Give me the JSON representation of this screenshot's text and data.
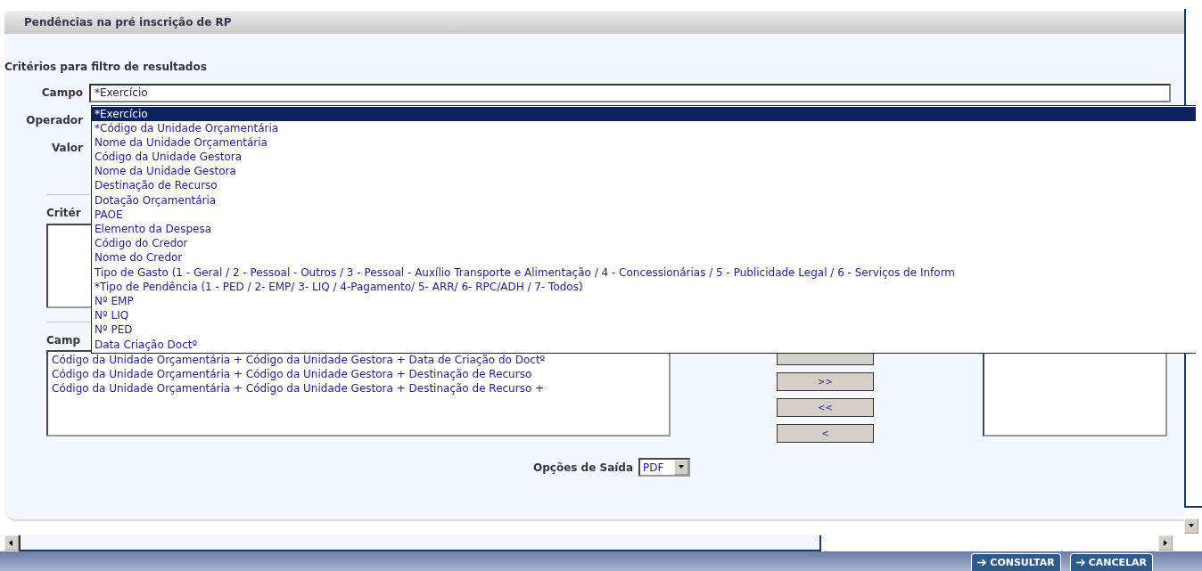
{
  "header": {
    "title": "Pendências na pré inscrição de RP"
  },
  "filter": {
    "title": "Critérios para filtro de resultados",
    "fields": [
      {
        "label": "Campo",
        "value": "*Exercício"
      },
      {
        "label": "Operador"
      },
      {
        "label": "Valor"
      }
    ]
  },
  "campo_options": [
    {
      "label": "*Exercício",
      "selected": true
    },
    {
      "label": "*Código da Unidade Orçamentária",
      "selected": false
    },
    {
      "label": "Nome da Unidade Orçamentária",
      "selected": false
    },
    {
      "label": "Código da Unidade Gestora",
      "selected": false
    },
    {
      "label": "Nome da Unidade Gestora",
      "selected": false
    },
    {
      "label": "Destinação de Recurso",
      "selected": false
    },
    {
      "label": "Dotação Orçamentária",
      "selected": false
    },
    {
      "label": "PAOE",
      "selected": false
    },
    {
      "label": "Elemento da Despesa",
      "selected": false
    },
    {
      "label": "Código do Credor",
      "selected": false
    },
    {
      "label": "Nome do Credor",
      "selected": false
    },
    {
      "label": "Tipo de Gasto (1 - Geral / 2 - Pessoal - Outros / 3 - Pessoal - Auxílio Transporte e Alimentação / 4 - Concessionárias / 5 - Publicidade Legal / 6 - Serviços de Inform",
      "selected": false
    },
    {
      "label": "*Tipo de Pendência (1 - PED / 2- EMP/ 3- LIQ / 4-Pagamento/ 5- ARR/ 6- RPC/ADH / 7- Todos)",
      "selected": false
    },
    {
      "label": "Nº EMP",
      "selected": false
    },
    {
      "label": "Nº LIQ",
      "selected": false
    },
    {
      "label": "Nº PED",
      "selected": false
    },
    {
      "label": "Data Criação Doctº",
      "selected": false
    }
  ],
  "criteria": {
    "title": "Critér"
  },
  "fields_section": {
    "title": "Camp",
    "available": [
      "Código da Unidade Orçamentária + Código da Unidade Gestora + Data de Criação do Doctº",
      "Código da Unidade Orçamentária + Código da Unidade Gestora + Destinação de Recurso",
      "Código da Unidade Orçamentária + Código da Unidade Gestora + Destinação de Recurso +"
    ],
    "buttons": [
      {
        "kind": "covered"
      },
      {
        "kind": "labeled",
        "label": ">>"
      },
      {
        "kind": "labeled",
        "label": "<<"
      },
      {
        "kind": "labeled",
        "label": "<"
      }
    ]
  },
  "output": {
    "label": "Opções de Saída",
    "value": "PDF"
  },
  "actions": [
    {
      "label": "CONSULTAR"
    },
    {
      "label": "CANCELAR"
    }
  ]
}
